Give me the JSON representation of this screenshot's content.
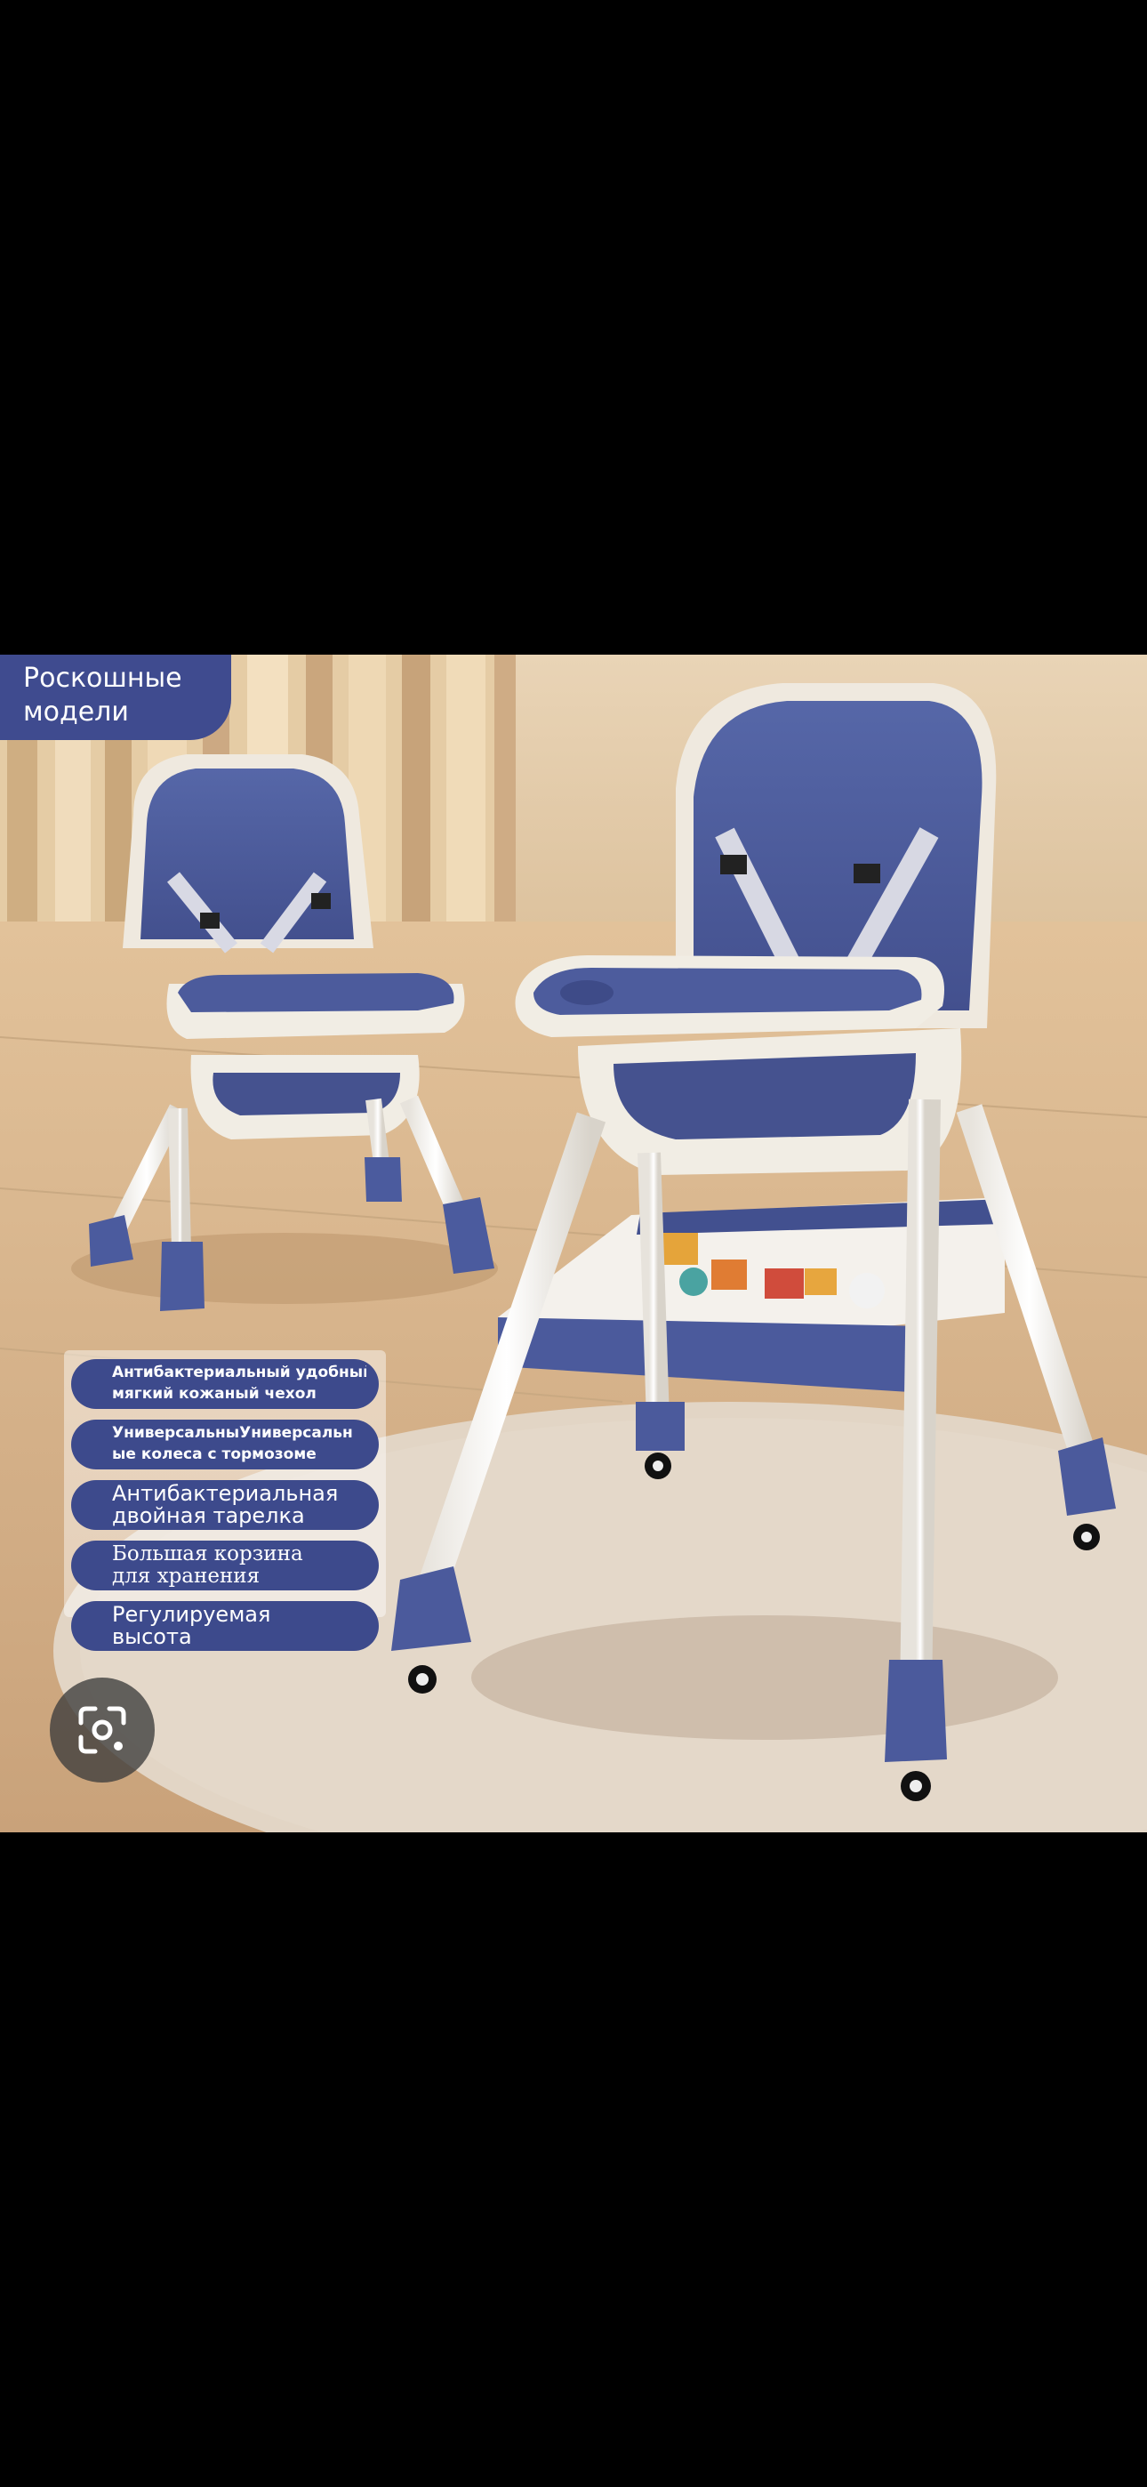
{
  "viewer": {
    "badge": {
      "line1": "Роскошные",
      "line2": "модели"
    },
    "features": [
      {
        "line1": "Антибактериальный удобный",
        "line2": "мягкий кожаный чехол"
      },
      {
        "line1": "УниверсальныУниверсальн",
        "line2": "ые колеса с тормозоме"
      },
      {
        "line1": "Антибактериальная",
        "line2": "двойная тарелка"
      },
      {
        "line1": "Большая корзина",
        "line2": "для хранения"
      },
      {
        "line1": "Регулируемая",
        "line2": "высота"
      }
    ],
    "lens_icon": "google-lens-icon",
    "colors": {
      "background": "#000000",
      "accent_blue": "#3f4b8f",
      "seat_blue": "#4f5f9e",
      "frame_white": "#f1ede4",
      "wall": "#e8d2b2",
      "floor": "#d9b98f",
      "rug": "#e3d7c8"
    }
  }
}
